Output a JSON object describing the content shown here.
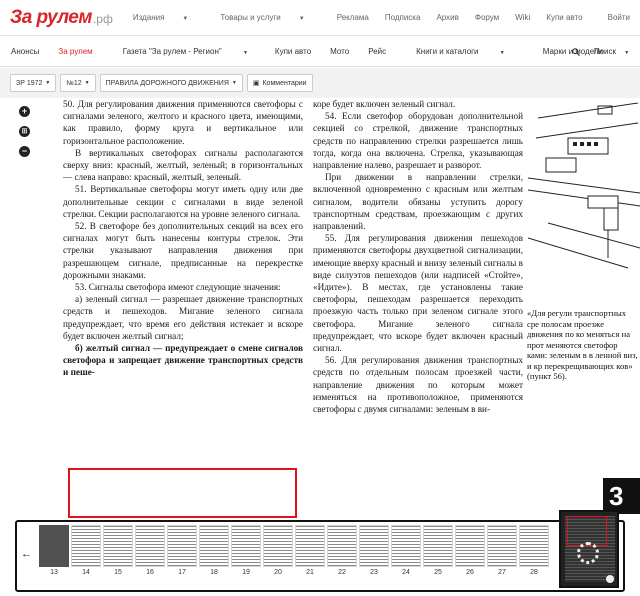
{
  "brand": {
    "name": "За рулем",
    "suffix": ".рф"
  },
  "topnav": {
    "items": [
      {
        "label": "Издания",
        "dropdown": true
      },
      {
        "label": "Товары и услуги",
        "dropdown": true
      },
      {
        "label": "Реклама",
        "dropdown": false
      },
      {
        "label": "Подписка",
        "dropdown": false
      },
      {
        "label": "Архив",
        "dropdown": false
      },
      {
        "label": "Форум",
        "dropdown": false
      },
      {
        "label": "Wiki",
        "dropdown": false
      },
      {
        "label": "Купи авто",
        "dropdown": false
      }
    ],
    "login": "Войти"
  },
  "nav2": {
    "items": [
      {
        "label": "Анонсы",
        "active": false
      },
      {
        "label": "За рулем",
        "active": true
      },
      {
        "label": "Газета \"За рулем - Регион\"",
        "active": false,
        "dropdown": true
      },
      {
        "label": "Купи авто",
        "active": false
      },
      {
        "label": "Мото",
        "active": false
      },
      {
        "label": "Рейс",
        "active": false
      },
      {
        "label": "Книги и каталоги",
        "active": false,
        "dropdown": true
      },
      {
        "label": "Марки и модели",
        "active": false,
        "dropdown": true
      }
    ],
    "search": "Поиск"
  },
  "toolbar": {
    "year": "ЗР 1972",
    "issue": "№12",
    "section": "ПРАВИЛА ДОРОЖНОГО ДВИЖЕНИЯ",
    "comments": "Комментарии"
  },
  "zoom": {
    "in": "+",
    "fit": "⊞",
    "out": "−"
  },
  "article": {
    "col1": [
      "50. Для регулирования движения применяются светофоры с сигналами зеленого, желтого и красного цвета, имеющими, как правило, форму круга и вертикальное или горизонтальное расположение.",
      "В вертикальных светофорах сигналы располагаются сверху вниз: красный, желтый, зеленый; в горизонтальных — слева направо: красный, желтый, зеленый.",
      "51. Вертикальные светофоры могут иметь одну или две дополнительные секции с сигналами в виде зеленой стрелки. Секции располагаются на уровне зеленого сигнала.",
      "52. В светофоре без дополнительных секций на всех его сигналах могут быть нанесены контуры стрелок. Эти стрелки указывают направления движения при разрешающем сигнале, предписанные на перекрестке дорожными знаками.",
      "53. Сигналы светофора имеют следующие значения:",
      "а) зеленый сигнал — разрешает движение транспортных средств и пешеходов. Мигание зеленого сигнала предупреждает, что время его действия истекает и вскоре будет включен желтый сигнал;",
      "б) желтый сигнал — предупреждает о смене сигналов светофора и запрещает движение транспортных средств и пеше-"
    ],
    "col2": [
      "коре будет включен зеленый сигнал.",
      "54. Если светофор оборудован дополнительной секцией со стрелкой, движение транспортных средств по направлению стрелки разрешается лишь тогда, когда она включена. Стрелка, указывающая направление налево, разрешает и разворот.",
      "При движении в направлении стрелки, включенной одновременно с красным или желтым сигналом, водители обязаны уступить дорогу транспортным средствам, проезжающим с других направлений.",
      "55. Для регулирования движения пешеходов применяются светофоры двухцветной сигнализации, имеющие вверху красный и внизу зеленый сигналы в виде силуэтов пешеходов (или надписей «Стойте», «Идите»). В местах, где установлены такие светофоры, пешеходам разрешается переходить проезжую часть только при зеленом сигнале этого светофора. Мигание зеленого сигнала предупреждает, что вскоре будет включен красный сигнал.",
      "56. Для регулирования движения транспортных средств по отдельным полосам проезжей части, направление движения по которым может изменяться на противоположное, применяются светофоры с двумя сигналами: зеленым в ви-"
    ],
    "caption": "«Для регули транспортных сре полосам проезже движения по ко меняться на прот меняются светофор ками: зеленым в в ленной виз, и кр перекрещивающих ков» (пункт 56).",
    "page_badge": "3"
  },
  "thumbnails": [
    "13",
    "14",
    "15",
    "16",
    "17",
    "18",
    "19",
    "20",
    "21",
    "22",
    "23",
    "24",
    "25",
    "26",
    "27",
    "28"
  ],
  "strip": {
    "back_arrow": "←"
  }
}
